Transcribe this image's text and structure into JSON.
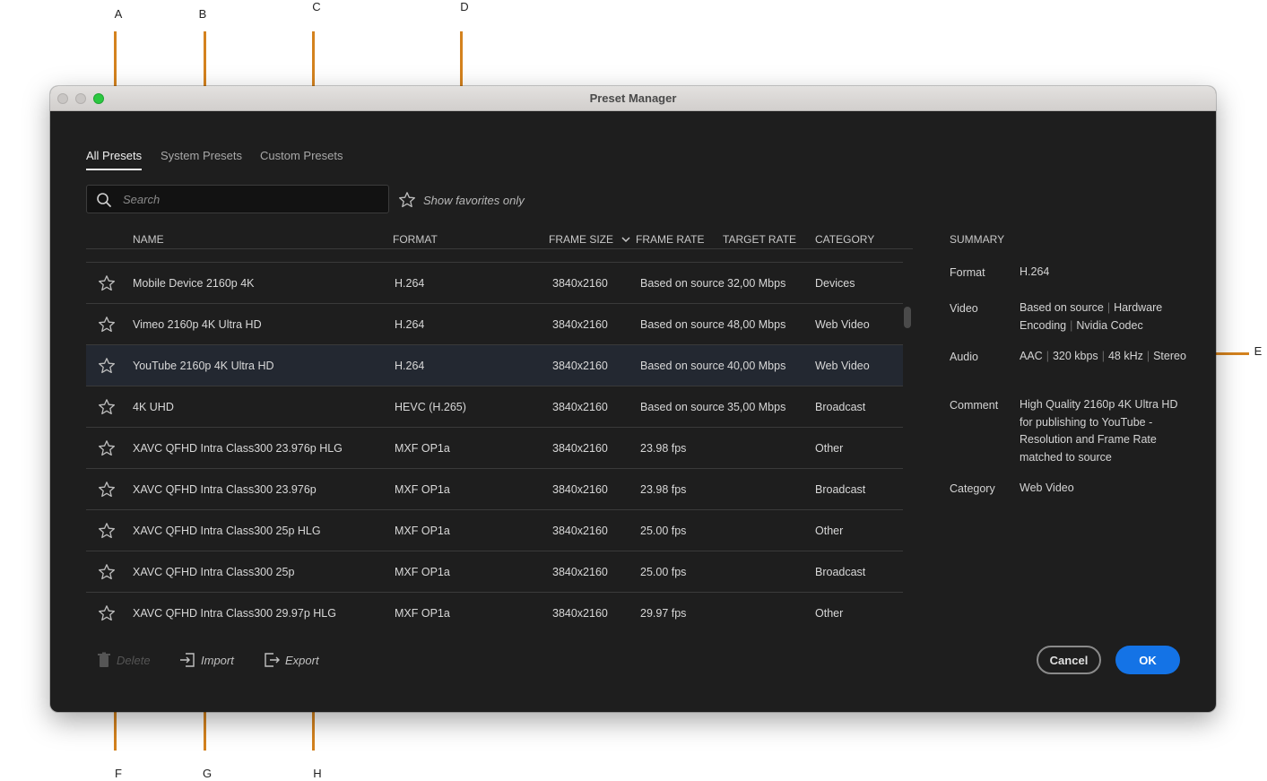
{
  "callouts": [
    "A",
    "B",
    "C",
    "D",
    "E",
    "F",
    "G",
    "H"
  ],
  "window": {
    "title": "Preset Manager"
  },
  "tabs": [
    {
      "label": "All Presets",
      "active": true
    },
    {
      "label": "System Presets",
      "active": false
    },
    {
      "label": "Custom Presets",
      "active": false
    }
  ],
  "search": {
    "placeholder": "Search",
    "value": ""
  },
  "favorites": {
    "label": "Show favorites only"
  },
  "table": {
    "headers": {
      "name": "NAME",
      "format": "FORMAT",
      "frame_size": "FRAME SIZE",
      "frame_rate": "FRAME RATE",
      "target_rate": "TARGET RATE",
      "category": "CATEGORY"
    },
    "rows": [
      {
        "name": "Mobile Device 2160p 4K",
        "format": "H.264",
        "frame_size": "3840x2160",
        "frame_rate": "Based on source",
        "target_rate": "32,00 Mbps",
        "category": "Devices",
        "selected": false
      },
      {
        "name": "Vimeo 2160p 4K Ultra HD",
        "format": "H.264",
        "frame_size": "3840x2160",
        "frame_rate": "Based on source",
        "target_rate": "48,00 Mbps",
        "category": "Web Video",
        "selected": false
      },
      {
        "name": "YouTube 2160p 4K Ultra HD",
        "format": "H.264",
        "frame_size": "3840x2160",
        "frame_rate": "Based on source",
        "target_rate": "40,00 Mbps",
        "category": "Web Video",
        "selected": true
      },
      {
        "name": "4K UHD",
        "format": "HEVC (H.265)",
        "frame_size": "3840x2160",
        "frame_rate": "Based on source",
        "target_rate": "35,00 Mbps",
        "category": "Broadcast",
        "selected": false
      },
      {
        "name": "XAVC QFHD Intra Class300 23.976p HLG",
        "format": "MXF OP1a",
        "frame_size": "3840x2160",
        "frame_rate": "23.98 fps",
        "target_rate": "",
        "category": "Other",
        "selected": false
      },
      {
        "name": "XAVC QFHD Intra Class300 23.976p",
        "format": "MXF OP1a",
        "frame_size": "3840x2160",
        "frame_rate": "23.98 fps",
        "target_rate": "",
        "category": "Broadcast",
        "selected": false
      },
      {
        "name": "XAVC QFHD Intra Class300 25p HLG",
        "format": "MXF OP1a",
        "frame_size": "3840x2160",
        "frame_rate": "25.00 fps",
        "target_rate": "",
        "category": "Other",
        "selected": false
      },
      {
        "name": "XAVC QFHD Intra Class300 25p",
        "format": "MXF OP1a",
        "frame_size": "3840x2160",
        "frame_rate": "25.00 fps",
        "target_rate": "",
        "category": "Broadcast",
        "selected": false
      },
      {
        "name": "XAVC QFHD Intra Class300 29.97p HLG",
        "format": "MXF OP1a",
        "frame_size": "3840x2160",
        "frame_rate": "29.97 fps",
        "target_rate": "",
        "category": "Other",
        "selected": false
      }
    ]
  },
  "summary": {
    "title": "SUMMARY",
    "format_label": "Format",
    "format_value": "H.264",
    "video_label": "Video",
    "video_values": [
      "Based on source",
      "Hardware Encoding",
      "Nvidia Codec"
    ],
    "audio_label": "Audio",
    "audio_values": [
      "AAC",
      "320 kbps",
      "48 kHz",
      "Stereo"
    ],
    "comment_label": "Comment",
    "comment_value": "High Quality 2160p 4K Ultra HD for publishing to YouTube - Resolution and Frame Rate matched to source",
    "category_label": "Category",
    "category_value": "Web Video"
  },
  "footer": {
    "delete_label": "Delete",
    "import_label": "Import",
    "export_label": "Export",
    "cancel_label": "Cancel",
    "ok_label": "OK"
  },
  "colors": {
    "accent": "#1473e6",
    "callout": "#d4821e",
    "window_bg": "#1e1e1e",
    "selected_row": "#232831"
  },
  "icons": [
    "search-icon",
    "star-outline-icon",
    "chevron-down-icon",
    "trash-icon",
    "import-icon",
    "export-icon"
  ]
}
